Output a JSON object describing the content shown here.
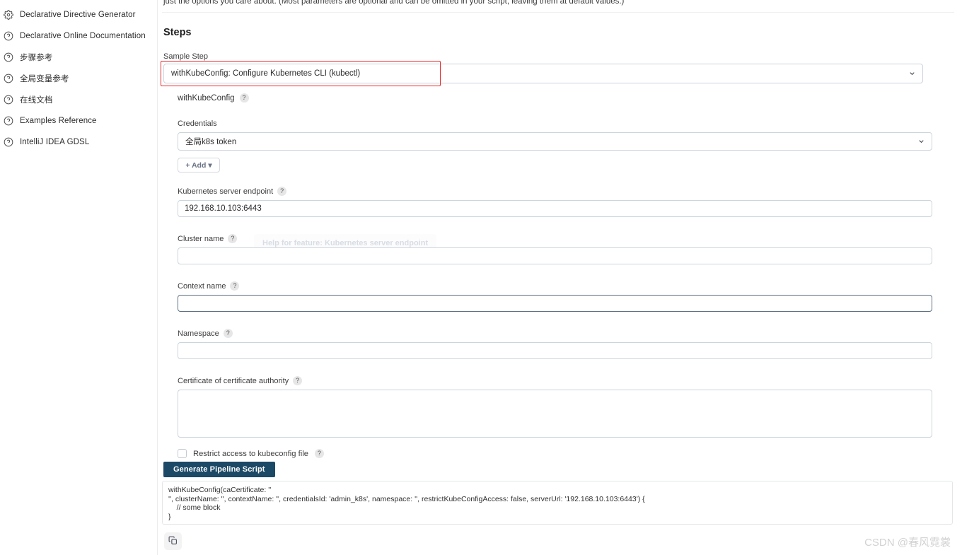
{
  "sidebar": {
    "items": [
      {
        "label": "Declarative Directive Generator",
        "icon": "gear-icon"
      },
      {
        "label": "Declarative Online Documentation",
        "icon": "question-circle-icon"
      },
      {
        "label": "步骤参考",
        "icon": "question-circle-icon"
      },
      {
        "label": "全局变量参考",
        "icon": "question-circle-icon"
      },
      {
        "label": "在线文档",
        "icon": "question-circle-icon"
      },
      {
        "label": "Examples Reference",
        "icon": "question-circle-icon"
      },
      {
        "label": "IntelliJ IDEA GDSL",
        "icon": "question-circle-icon"
      }
    ]
  },
  "main": {
    "intro_text": "just the options you care about. (Most parameters are optional and can be omitted in your script, leaving them at default values.)",
    "section_title": "Steps",
    "sample_step": {
      "label": "Sample Step",
      "selected": "withKubeConfig: Configure Kubernetes CLI (kubectl)"
    },
    "step_name": "withKubeConfig",
    "help_glyph": "?",
    "tooltip_ghost": "Help for feature: Kubernetes server endpoint",
    "fields": {
      "credentials": {
        "label": "Credentials",
        "value": "全局k8s token"
      },
      "add_button": {
        "label": "+ Add",
        "caret": "▾"
      },
      "server_endpoint": {
        "label": "Kubernetes server endpoint",
        "value": "192.168.10.103:6443"
      },
      "cluster_name": {
        "label": "Cluster name",
        "value": ""
      },
      "context_name": {
        "label": "Context name",
        "value": ""
      },
      "namespace": {
        "label": "Namespace",
        "value": ""
      },
      "certificate": {
        "label": "Certificate of certificate authority",
        "value": ""
      },
      "restrict_access": {
        "label": "Restrict access to kubeconfig file",
        "checked": false
      }
    },
    "generate_button": "Generate Pipeline Script",
    "generated_script": "withKubeConfig(caCertificate: ''\n'', clusterName: '', contextName: '', credentialsId: 'admin_k8s', namespace: '', restrictKubeConfigAccess: false, serverUrl: '192.168.10.103:6443') {\n    // some block\n}",
    "copy_button_name": "copy-icon"
  },
  "watermark": "CSDN @春风霓裳",
  "colors": {
    "accent": "#1c4966",
    "annotation": "#e8282b",
    "border": "#ccd4dc"
  }
}
